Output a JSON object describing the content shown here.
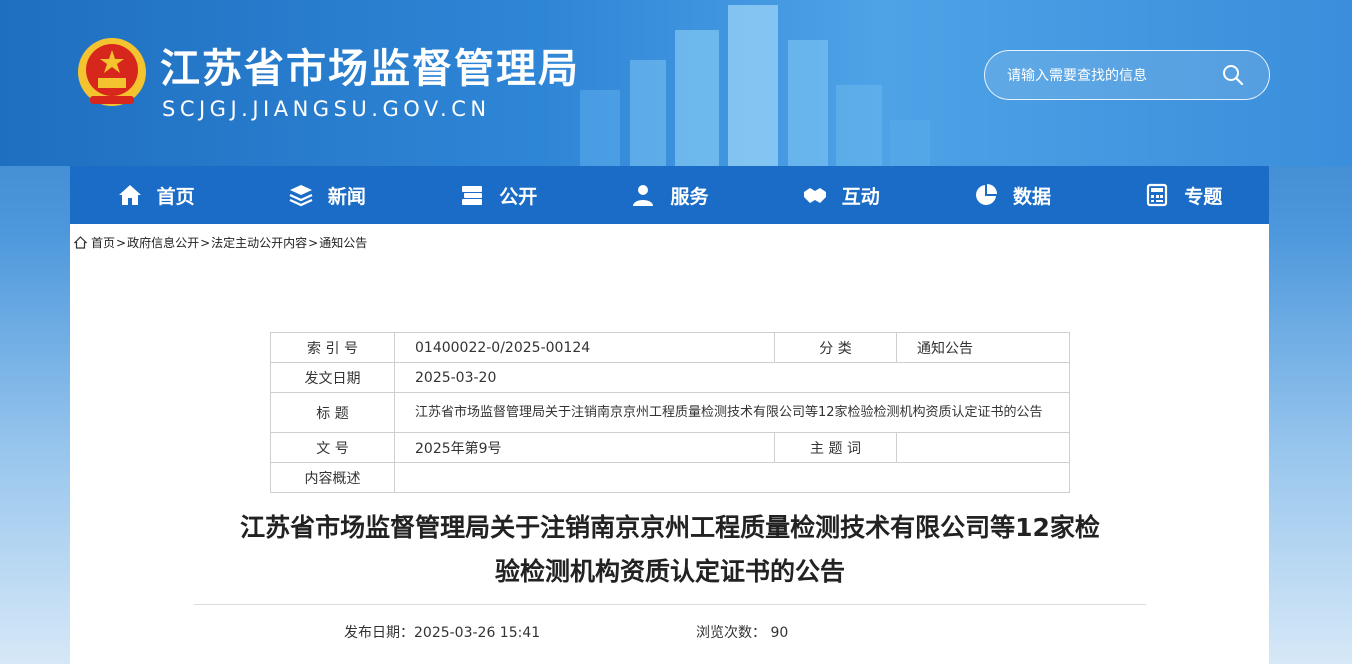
{
  "header": {
    "title": "江苏省市场监督管理局",
    "domain": "SCJGJ.JIANGSU.GOV.CN",
    "search_placeholder": "请输入需要查找的信息"
  },
  "nav": [
    {
      "label": "首页",
      "icon": "home-icon"
    },
    {
      "label": "新闻",
      "icon": "layers-icon"
    },
    {
      "label": "公开",
      "icon": "documents-icon"
    },
    {
      "label": "服务",
      "icon": "users-icon"
    },
    {
      "label": "互动",
      "icon": "handshake-icon"
    },
    {
      "label": "数据",
      "icon": "pie-chart-icon"
    },
    {
      "label": "专题",
      "icon": "calculator-icon"
    }
  ],
  "breadcrumb": [
    "首页",
    "政府信息公开",
    "法定主动公开内容",
    "通知公告"
  ],
  "meta": {
    "index_label": "索 引 号",
    "index_value": "01400022-0/2025-00124",
    "category_label": "分 类",
    "category_value": "通知公告",
    "date_label": "发文日期",
    "date_value": "2025-03-20",
    "title_label": "标 题",
    "title_value": "江苏省市场监督管理局关于注销南京京州工程质量检测技术有限公司等12家检验检测机构资质认定证书的公告",
    "docno_label": "文 号",
    "docno_value": "2025年第9号",
    "keywords_label": "主 题 词",
    "keywords_value": "",
    "summary_label": "内容概述",
    "summary_value": ""
  },
  "article": {
    "title_line1": "江苏省市场监督管理局关于注销南京京州工程质量检测技术有限公司等12家检",
    "title_line2": "验检测机构资质认定证书的公告",
    "publish_text": "发布日期：2025-03-26 15:41",
    "views_text": "浏览次数： 90"
  },
  "colors": {
    "nav_bg": "#1a6cc6",
    "banner": "#2f86d6",
    "emblem_red": "#d7261b",
    "emblem_gold": "#f4c430"
  }
}
